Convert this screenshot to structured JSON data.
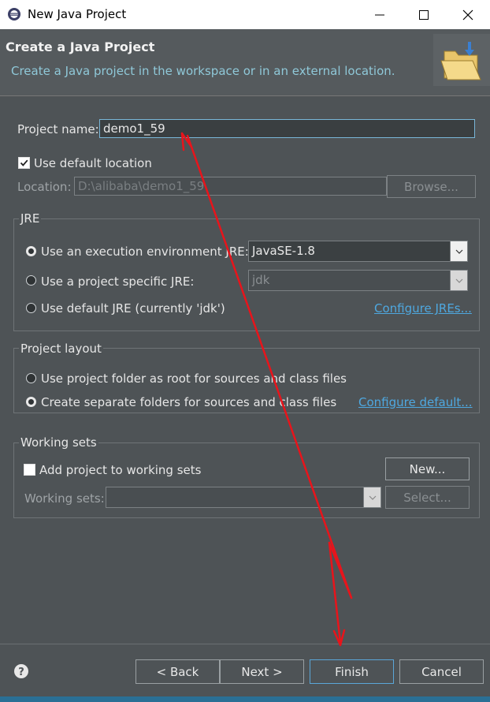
{
  "window": {
    "title": "New Java Project"
  },
  "header": {
    "title": "Create a Java Project",
    "description": "Create a Java project in the workspace or in an external location."
  },
  "project": {
    "name_label": "Project name:",
    "name_value": "demo1_59",
    "use_default_location_label": "Use default location",
    "use_default_location_checked": true,
    "location_label": "Location:",
    "location_value": "D:\\alibaba\\demo1_59",
    "browse_label": "Browse..."
  },
  "jre": {
    "group_title": "JRE",
    "option_exec_env": "Use an execution environment JRE:",
    "exec_env_value": "JavaSE-1.8",
    "option_project_specific": "Use a project specific JRE:",
    "project_specific_value": "jdk",
    "option_default": "Use default JRE (currently 'jdk')",
    "configure_link": "Configure JREs...",
    "selected_option": "exec_env"
  },
  "layout": {
    "group_title": "Project layout",
    "option_root": "Use project folder as root for sources and class files",
    "option_separate": "Create separate folders for sources and class files",
    "configure_link": "Configure default...",
    "selected_option": "separate"
  },
  "working_sets": {
    "group_title": "Working sets",
    "add_label": "Add project to working sets",
    "add_checked": false,
    "new_button": "New...",
    "sets_label": "Working sets:",
    "select_button": "Select..."
  },
  "footer": {
    "back_button": "< Back",
    "next_button": "Next >",
    "finish_button": "Finish",
    "cancel_button": "Cancel"
  },
  "colors": {
    "annotation_arrow": "#e8141b",
    "link": "#4ea8e0",
    "header_description": "#8fc8d8"
  }
}
